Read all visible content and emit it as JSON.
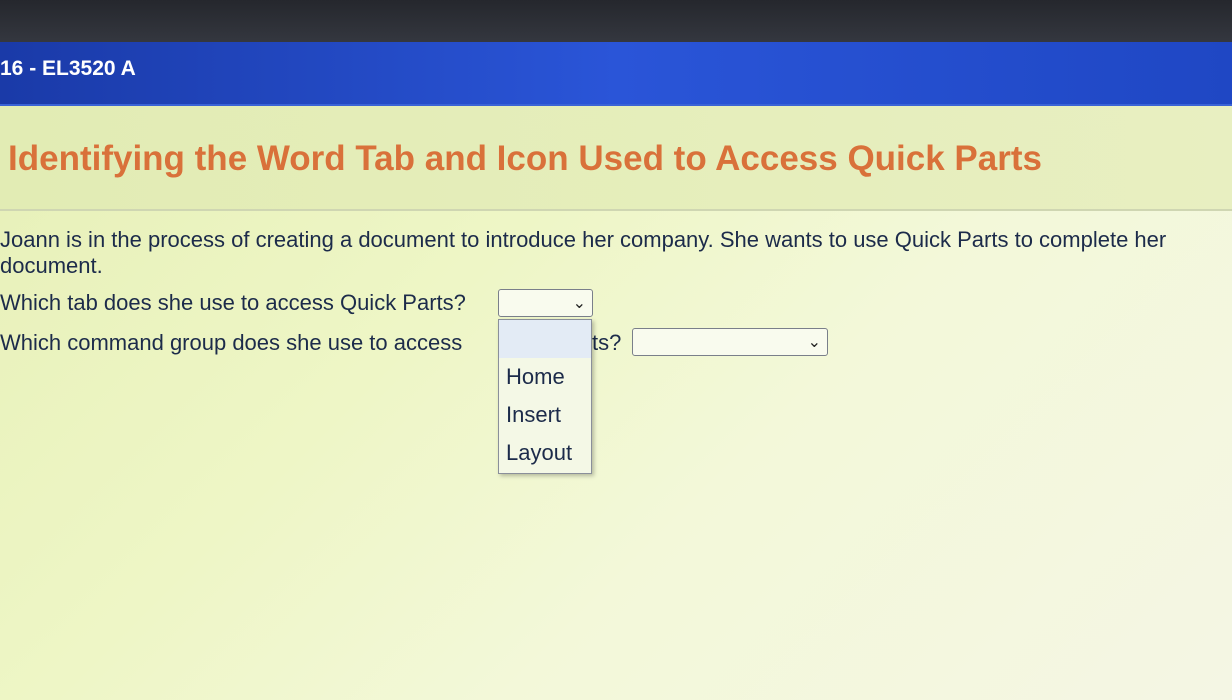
{
  "header": {
    "course_code": "16 - EL3520 A"
  },
  "main": {
    "title": "Identifying the Word Tab and Icon Used to Access Quick Parts",
    "paragraph": "Joann is in the process of creating a document to introduce her company. She wants to use Quick Parts to complete her document.",
    "questions": [
      {
        "text": "Which tab does she use to access Quick Parts?",
        "selected": "",
        "dropdown_open": true,
        "options": [
          "",
          "Home",
          "Insert",
          "Layout"
        ]
      },
      {
        "text_visible_start": "Which command group does she use to access",
        "text_visible_end": "ts?",
        "selected": "",
        "dropdown_open": false
      }
    ]
  },
  "icons": {
    "select_chevron": "chevron-down-icon"
  },
  "colors": {
    "header_blue": "#2a55d8",
    "title_orange": "#d9713a",
    "text_dark": "#1c2b4a",
    "page_bg": "#eef6c6"
  }
}
